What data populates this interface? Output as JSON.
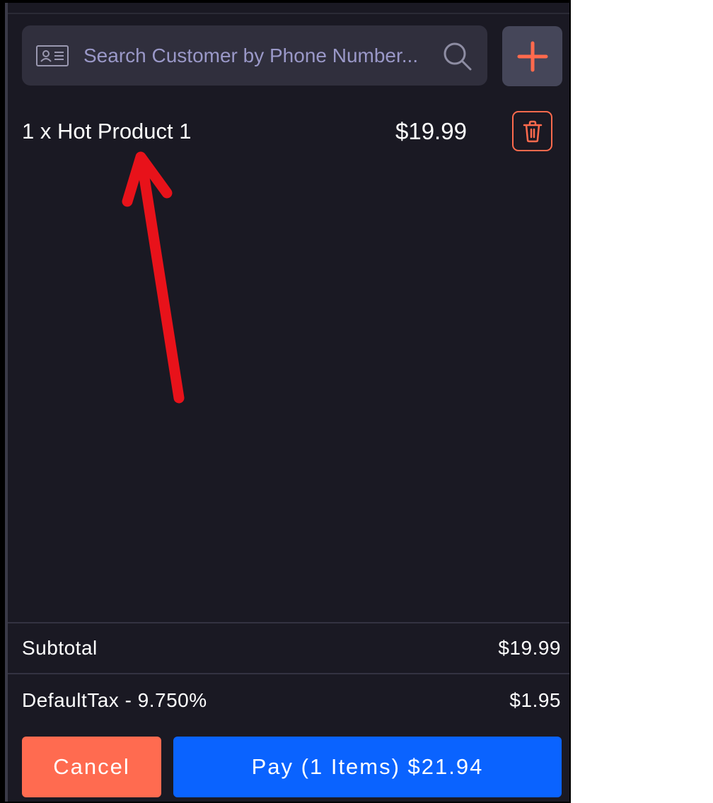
{
  "search": {
    "placeholder": "Search Customer by Phone Number...",
    "icon": "search-icon",
    "card_icon": "id-card-icon"
  },
  "add_button": {
    "icon": "plus-icon"
  },
  "cart": {
    "items": [
      {
        "label": "1 x Hot Product 1",
        "price": "$19.99",
        "delete_icon": "trash-icon"
      }
    ]
  },
  "summary": {
    "subtotal_label": "Subtotal",
    "subtotal_value": "$19.99",
    "tax_label": "DefaultTax - 9.750%",
    "tax_value": "$1.95"
  },
  "actions": {
    "cancel_label": "Cancel",
    "pay_label": "Pay (1 Items) $21.94"
  },
  "colors": {
    "background": "#1a1923",
    "accent_orange": "#ff6b50",
    "pay_blue": "#0a63ff",
    "annotation_red": "#e8121a"
  }
}
